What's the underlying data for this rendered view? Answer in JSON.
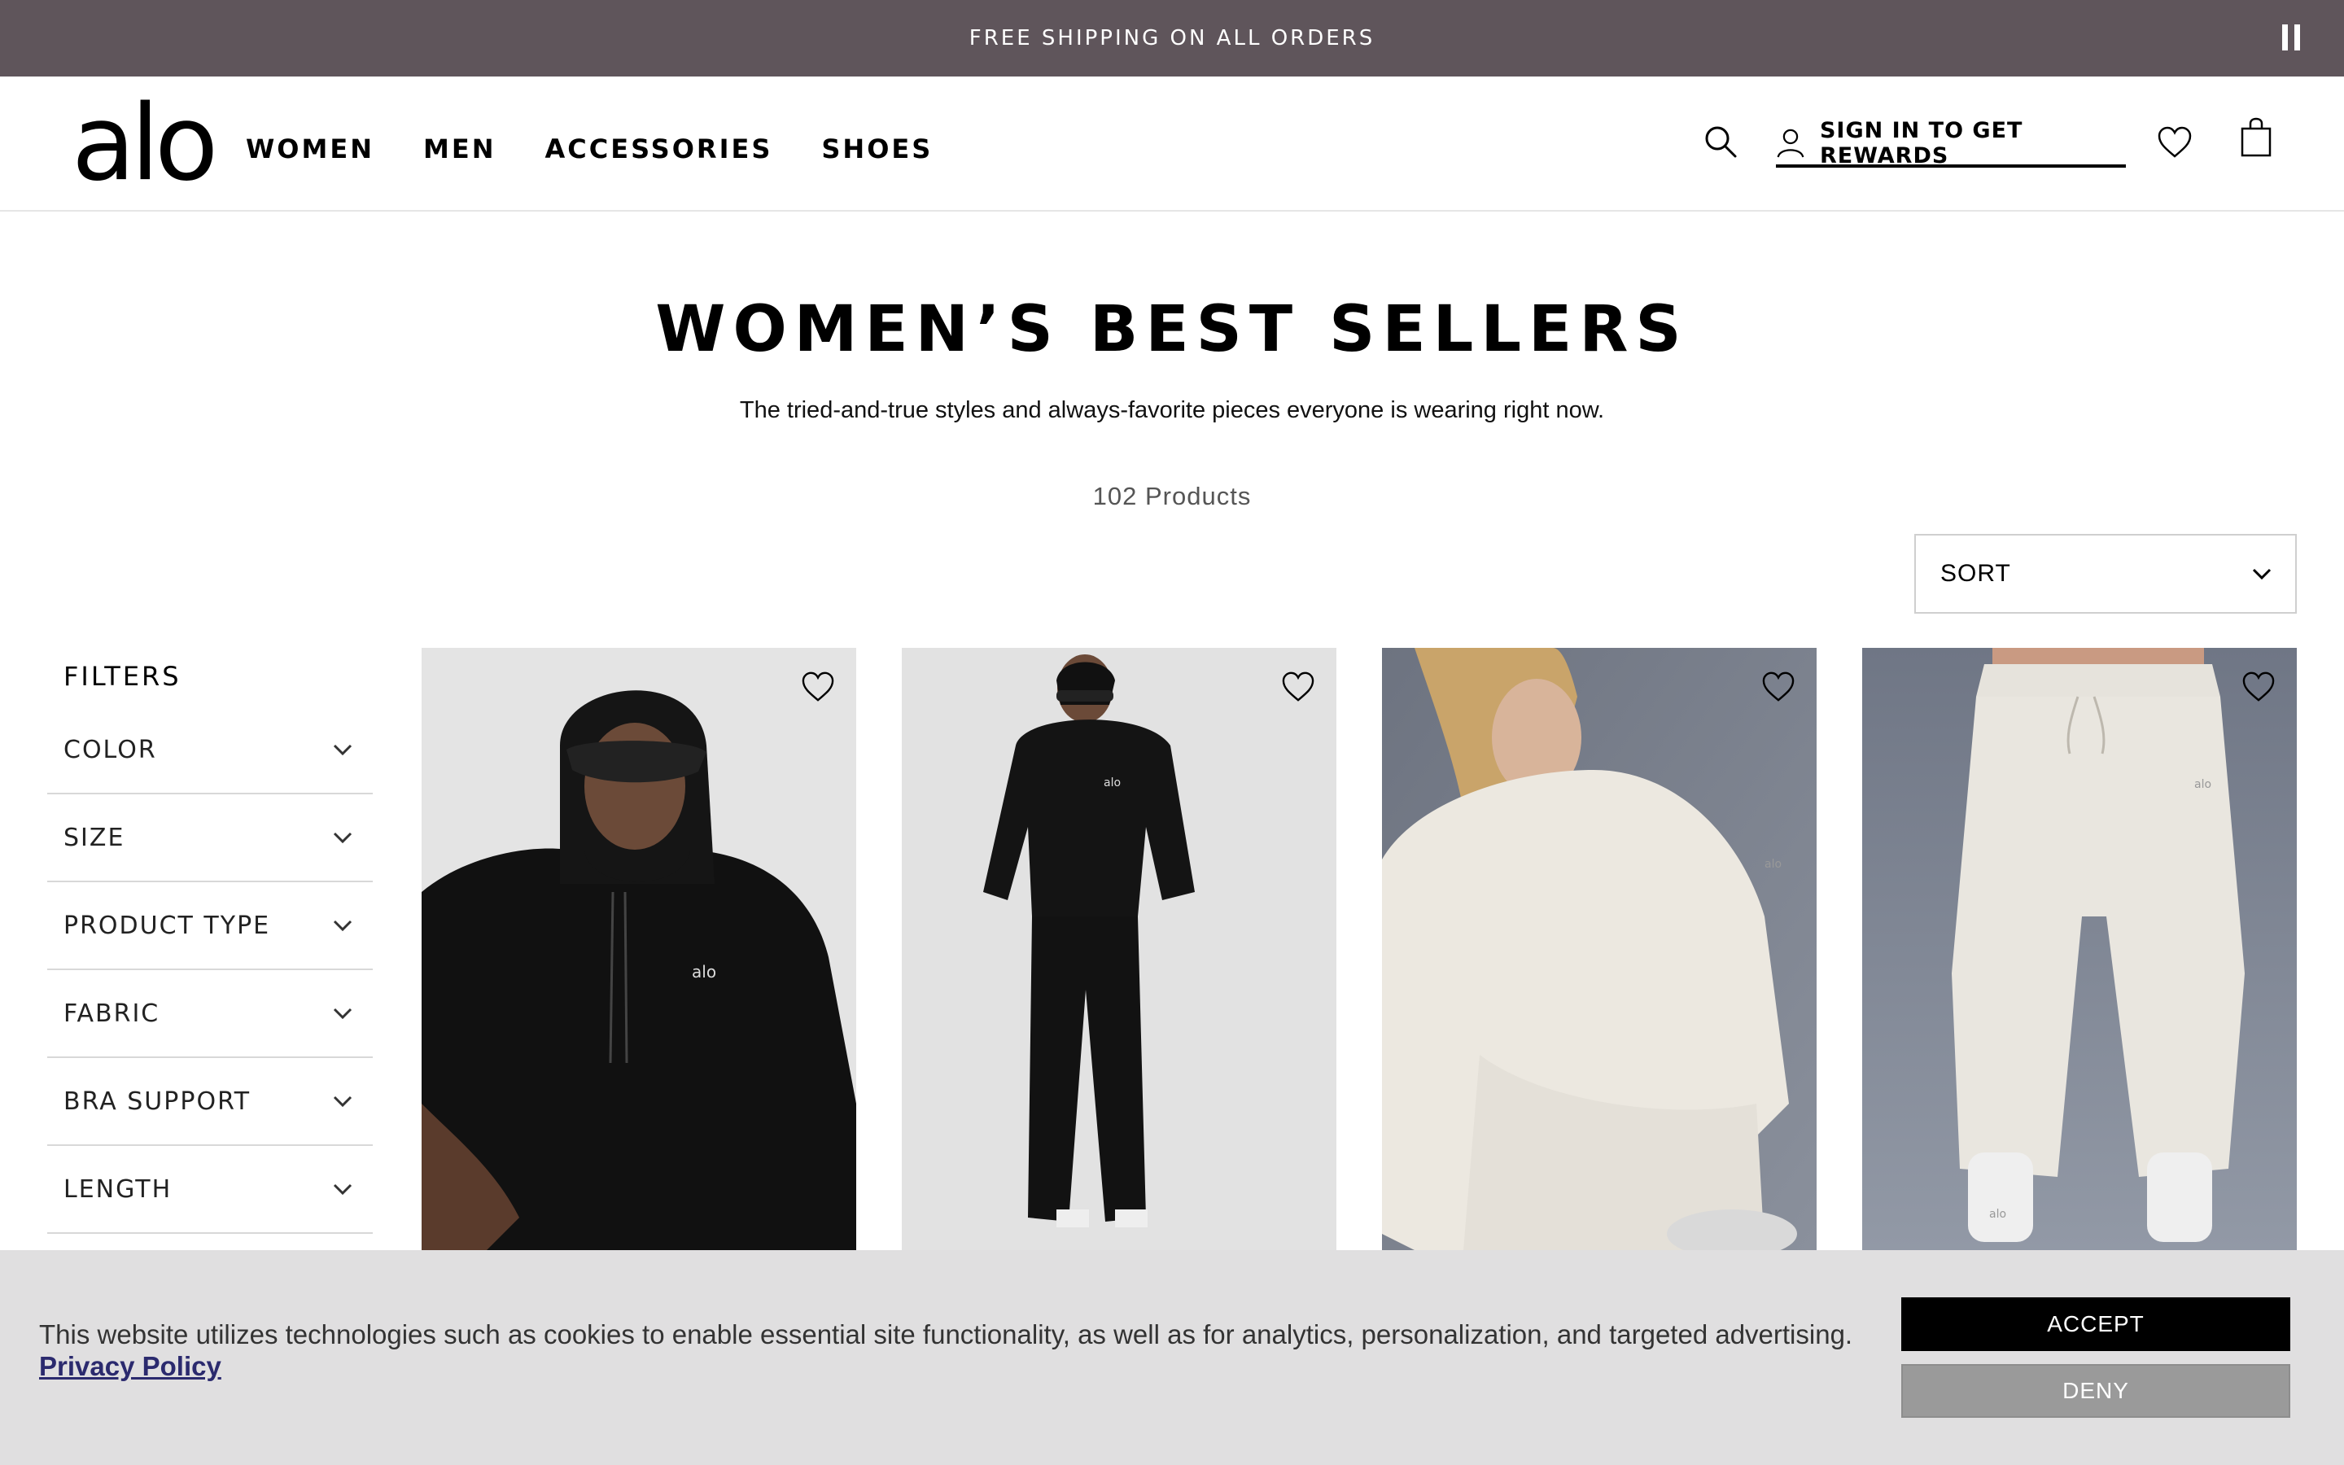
{
  "promo": {
    "text": "FREE SHIPPING ON ALL ORDERS",
    "pause_icon": "pause-icon"
  },
  "header": {
    "logo": "alo",
    "nav": [
      "WOMEN",
      "MEN",
      "ACCESSORIES",
      "SHOES"
    ],
    "rewards_label": "SIGN IN TO GET REWARDS",
    "icons": [
      "search-icon",
      "user-icon",
      "heart-icon",
      "bag-icon"
    ]
  },
  "page": {
    "title": "WOMEN’S BEST SELLERS",
    "subtitle": "The tried-and-true styles and always-favorite pieces everyone is wearing right now.",
    "count": "102 Products",
    "sort_label": "SORT"
  },
  "filters": {
    "title": "FILTERS",
    "items": [
      "COLOR",
      "SIZE",
      "PRODUCT TYPE",
      "FABRIC",
      "BRA SUPPORT",
      "LENGTH"
    ]
  },
  "products": [
    {
      "image": "model-black-hoodie-sunglasses",
      "bg": "#e4e4e4"
    },
    {
      "image": "model-black-hoodie-sweatpants",
      "bg": "#e2e2e2"
    },
    {
      "image": "model-cream-waffle-pullover",
      "bg": "#6e7784"
    },
    {
      "image": "model-cream-waffle-sweatpants",
      "bg": "#7a8290"
    }
  ],
  "cookie": {
    "text": "This website utilizes technologies such as cookies to enable essential site functionality, as well as for analytics, personalization, and targeted advertising.",
    "privacy": "Privacy Policy",
    "accept": "ACCEPT",
    "deny": "DENY"
  },
  "colors": {
    "promo_bg": "#5f555b",
    "cookie_bg": "#e0dfe0",
    "accept_bg": "#000000",
    "deny_bg": "#9a9a9a",
    "privacy_link": "#2b2a6e"
  }
}
